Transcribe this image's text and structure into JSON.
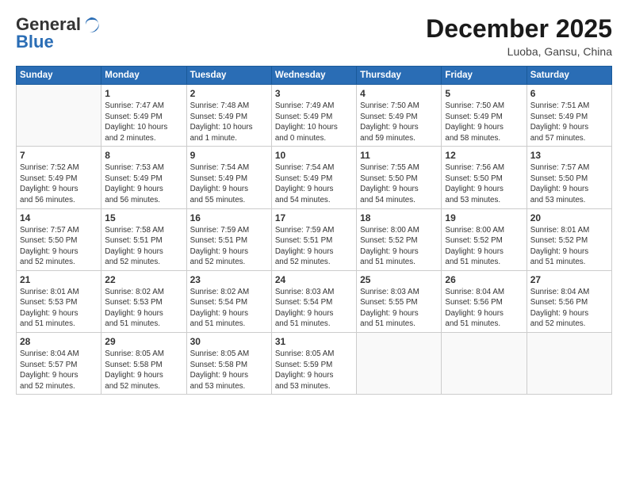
{
  "logo": {
    "general": "General",
    "blue": "Blue"
  },
  "header": {
    "title": "December 2025",
    "subtitle": "Luoba, Gansu, China"
  },
  "weekdays": [
    "Sunday",
    "Monday",
    "Tuesday",
    "Wednesday",
    "Thursday",
    "Friday",
    "Saturday"
  ],
  "weeks": [
    [
      {
        "date": "",
        "info": ""
      },
      {
        "date": "1",
        "info": "Sunrise: 7:47 AM\nSunset: 5:49 PM\nDaylight: 10 hours\nand 2 minutes."
      },
      {
        "date": "2",
        "info": "Sunrise: 7:48 AM\nSunset: 5:49 PM\nDaylight: 10 hours\nand 1 minute."
      },
      {
        "date": "3",
        "info": "Sunrise: 7:49 AM\nSunset: 5:49 PM\nDaylight: 10 hours\nand 0 minutes."
      },
      {
        "date": "4",
        "info": "Sunrise: 7:50 AM\nSunset: 5:49 PM\nDaylight: 9 hours\nand 59 minutes."
      },
      {
        "date": "5",
        "info": "Sunrise: 7:50 AM\nSunset: 5:49 PM\nDaylight: 9 hours\nand 58 minutes."
      },
      {
        "date": "6",
        "info": "Sunrise: 7:51 AM\nSunset: 5:49 PM\nDaylight: 9 hours\nand 57 minutes."
      }
    ],
    [
      {
        "date": "7",
        "info": "Sunrise: 7:52 AM\nSunset: 5:49 PM\nDaylight: 9 hours\nand 56 minutes."
      },
      {
        "date": "8",
        "info": "Sunrise: 7:53 AM\nSunset: 5:49 PM\nDaylight: 9 hours\nand 56 minutes."
      },
      {
        "date": "9",
        "info": "Sunrise: 7:54 AM\nSunset: 5:49 PM\nDaylight: 9 hours\nand 55 minutes."
      },
      {
        "date": "10",
        "info": "Sunrise: 7:54 AM\nSunset: 5:49 PM\nDaylight: 9 hours\nand 54 minutes."
      },
      {
        "date": "11",
        "info": "Sunrise: 7:55 AM\nSunset: 5:50 PM\nDaylight: 9 hours\nand 54 minutes."
      },
      {
        "date": "12",
        "info": "Sunrise: 7:56 AM\nSunset: 5:50 PM\nDaylight: 9 hours\nand 53 minutes."
      },
      {
        "date": "13",
        "info": "Sunrise: 7:57 AM\nSunset: 5:50 PM\nDaylight: 9 hours\nand 53 minutes."
      }
    ],
    [
      {
        "date": "14",
        "info": "Sunrise: 7:57 AM\nSunset: 5:50 PM\nDaylight: 9 hours\nand 52 minutes."
      },
      {
        "date": "15",
        "info": "Sunrise: 7:58 AM\nSunset: 5:51 PM\nDaylight: 9 hours\nand 52 minutes."
      },
      {
        "date": "16",
        "info": "Sunrise: 7:59 AM\nSunset: 5:51 PM\nDaylight: 9 hours\nand 52 minutes."
      },
      {
        "date": "17",
        "info": "Sunrise: 7:59 AM\nSunset: 5:51 PM\nDaylight: 9 hours\nand 52 minutes."
      },
      {
        "date": "18",
        "info": "Sunrise: 8:00 AM\nSunset: 5:52 PM\nDaylight: 9 hours\nand 51 minutes."
      },
      {
        "date": "19",
        "info": "Sunrise: 8:00 AM\nSunset: 5:52 PM\nDaylight: 9 hours\nand 51 minutes."
      },
      {
        "date": "20",
        "info": "Sunrise: 8:01 AM\nSunset: 5:52 PM\nDaylight: 9 hours\nand 51 minutes."
      }
    ],
    [
      {
        "date": "21",
        "info": "Sunrise: 8:01 AM\nSunset: 5:53 PM\nDaylight: 9 hours\nand 51 minutes."
      },
      {
        "date": "22",
        "info": "Sunrise: 8:02 AM\nSunset: 5:53 PM\nDaylight: 9 hours\nand 51 minutes."
      },
      {
        "date": "23",
        "info": "Sunrise: 8:02 AM\nSunset: 5:54 PM\nDaylight: 9 hours\nand 51 minutes."
      },
      {
        "date": "24",
        "info": "Sunrise: 8:03 AM\nSunset: 5:54 PM\nDaylight: 9 hours\nand 51 minutes."
      },
      {
        "date": "25",
        "info": "Sunrise: 8:03 AM\nSunset: 5:55 PM\nDaylight: 9 hours\nand 51 minutes."
      },
      {
        "date": "26",
        "info": "Sunrise: 8:04 AM\nSunset: 5:56 PM\nDaylight: 9 hours\nand 51 minutes."
      },
      {
        "date": "27",
        "info": "Sunrise: 8:04 AM\nSunset: 5:56 PM\nDaylight: 9 hours\nand 52 minutes."
      }
    ],
    [
      {
        "date": "28",
        "info": "Sunrise: 8:04 AM\nSunset: 5:57 PM\nDaylight: 9 hours\nand 52 minutes."
      },
      {
        "date": "29",
        "info": "Sunrise: 8:05 AM\nSunset: 5:58 PM\nDaylight: 9 hours\nand 52 minutes."
      },
      {
        "date": "30",
        "info": "Sunrise: 8:05 AM\nSunset: 5:58 PM\nDaylight: 9 hours\nand 53 minutes."
      },
      {
        "date": "31",
        "info": "Sunrise: 8:05 AM\nSunset: 5:59 PM\nDaylight: 9 hours\nand 53 minutes."
      },
      {
        "date": "",
        "info": ""
      },
      {
        "date": "",
        "info": ""
      },
      {
        "date": "",
        "info": ""
      }
    ]
  ]
}
